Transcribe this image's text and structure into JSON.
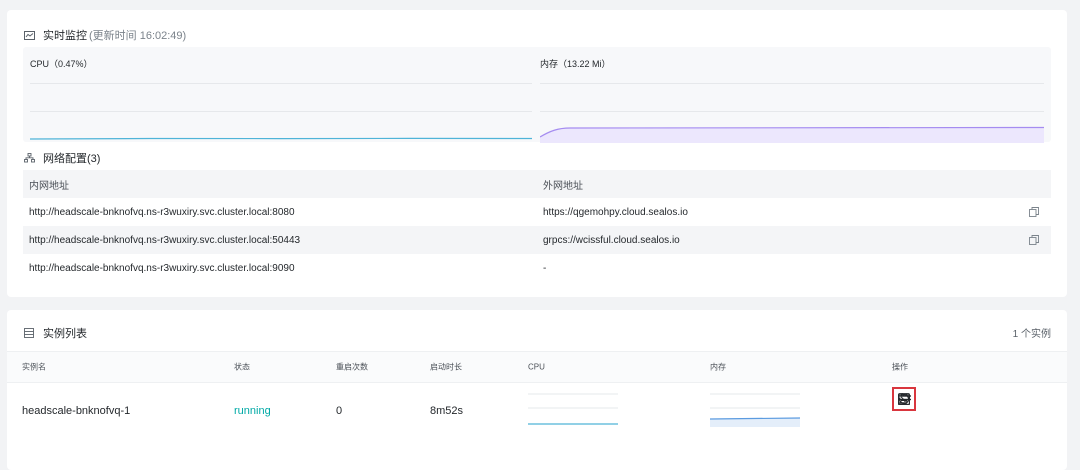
{
  "monitor": {
    "title": "实时监控",
    "updated": "(更新时间 16:02:49)",
    "cpu_label": "CPU（0.47%）",
    "mem_label": "内存（13.22 Mi）",
    "cpu_color": "#4fb4d8",
    "mem_color": "#a58cf0"
  },
  "network": {
    "title": "网络配置(3)",
    "headers": [
      "内网地址",
      "外网地址"
    ],
    "rows": [
      {
        "internal": "http://headscale-bnknofvq.ns-r3wuxiry.svc.cluster.local:8080",
        "external": "https://qgemohpy.cloud.sealos.io",
        "copy": true
      },
      {
        "internal": "http://headscale-bnknofvq.ns-r3wuxiry.svc.cluster.local:50443",
        "external": "grpcs://wcissful.cloud.sealos.io",
        "copy": true
      },
      {
        "internal": "http://headscale-bnknofvq.ns-r3wuxiry.svc.cluster.local:9090",
        "external": "-",
        "copy": false
      }
    ]
  },
  "instances": {
    "title": "实例列表",
    "count": "1 个实例",
    "headers": {
      "name": "实例名",
      "status": "状态",
      "restarts": "重启次数",
      "uptime": "启动时长",
      "cpu": "CPU",
      "memory": "内存",
      "actions": "操作"
    },
    "row": {
      "name": "headscale-bnknofvq-1",
      "status": "running",
      "restarts": "0",
      "uptime": "8m52s"
    },
    "action_icons": [
      "calendar-detail-icon",
      "terminal-icon",
      "logs-icon",
      "restart-icon"
    ],
    "status_color": "#00a9a6"
  }
}
